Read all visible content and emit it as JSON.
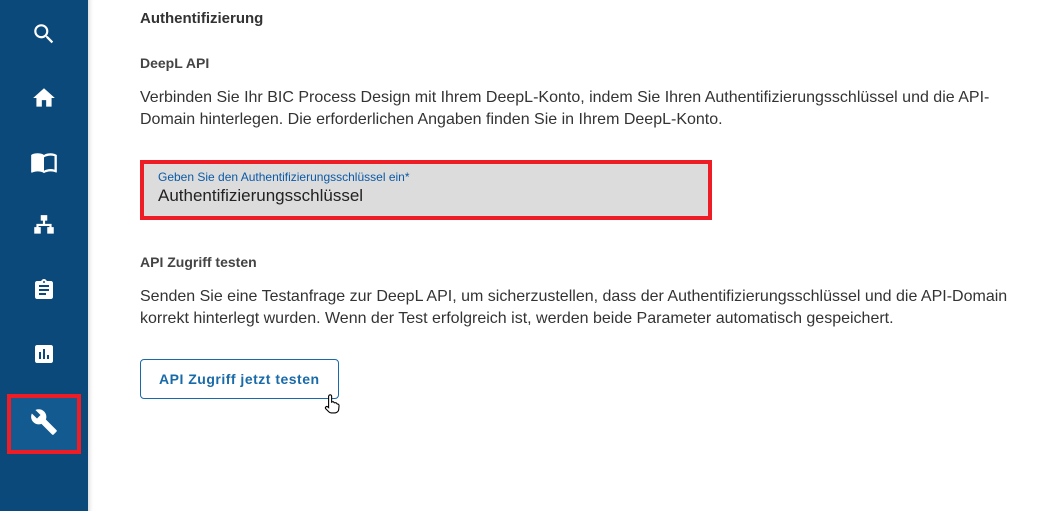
{
  "sidebar": {
    "items": [
      {
        "name": "search-icon"
      },
      {
        "name": "home-icon"
      },
      {
        "name": "book-icon"
      },
      {
        "name": "sitemap-icon"
      },
      {
        "name": "clipboard-icon"
      },
      {
        "name": "chart-icon"
      },
      {
        "name": "wrench-icon",
        "active": true
      }
    ]
  },
  "auth": {
    "header": "Authentifizierung",
    "api_header": "DeepL API",
    "api_desc": "Verbinden Sie Ihr BIC Process Design mit Ihrem DeepL-Konto, indem Sie Ihren Authentifizierungsschlüssel und die API-Domain hinterlegen. Die erforderlichen Angaben finden Sie in Ihrem DeepL-Konto.",
    "field_label": "Geben Sie den Authentifizierungsschlüssel ein*",
    "field_value": "Authentifizierungsschlüssel",
    "test_header": "API Zugriff testen",
    "test_desc": "Senden Sie eine Testanfrage zur DeepL API, um sicherzustellen, dass der Authentifizierungsschlüssel und die API-Domain korrekt hinterlegt wurden. Wenn der Test erfolgreich ist, werden beide Parameter automatisch gespeichert.",
    "test_button": "API Zugriff jetzt testen"
  }
}
